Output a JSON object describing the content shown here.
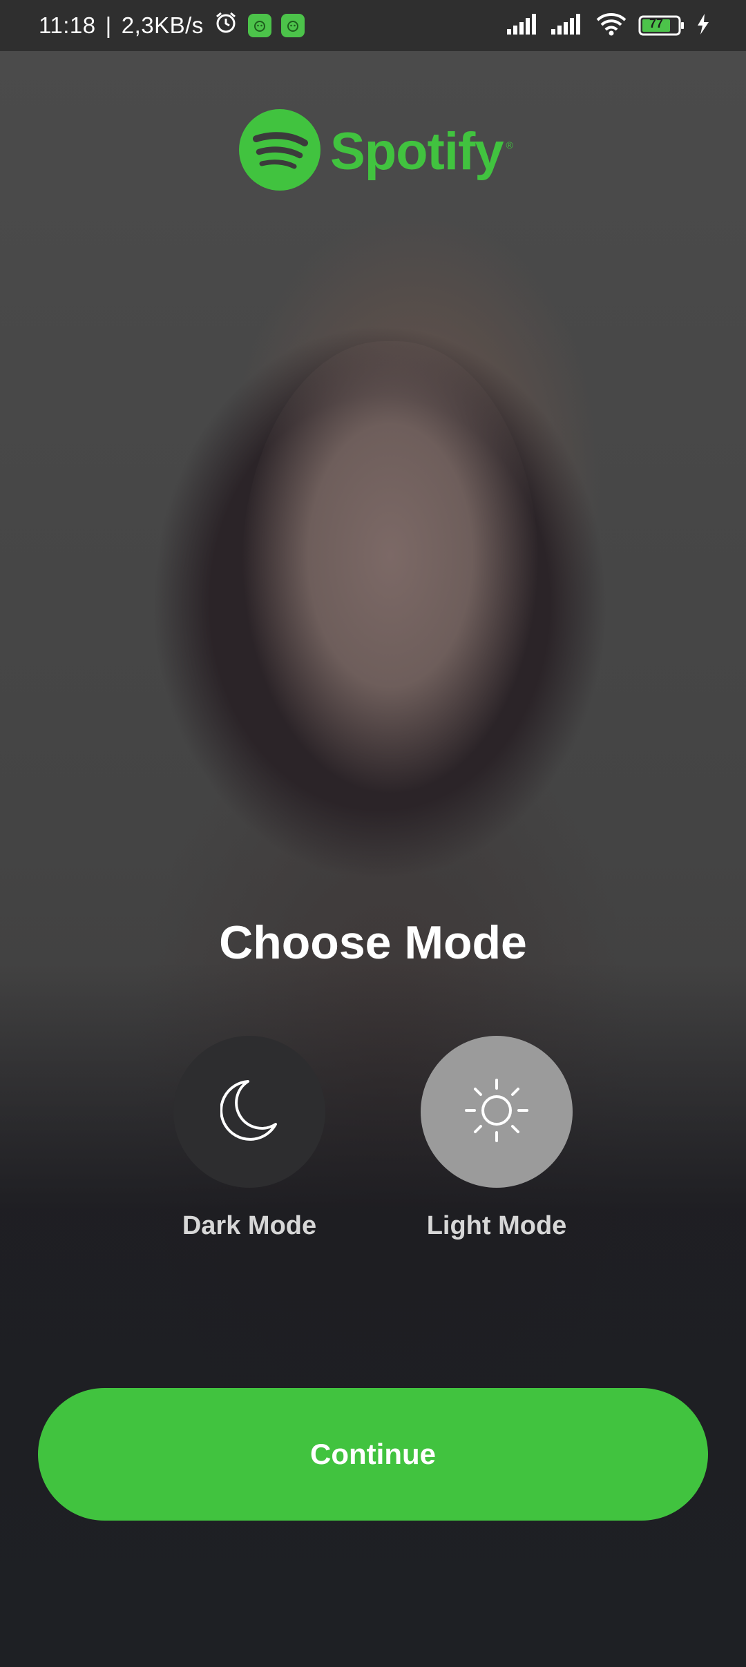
{
  "status_bar": {
    "time": "11:18",
    "separator": "|",
    "speed": "2,3KB/s",
    "battery": "77",
    "icons": [
      "alarm-icon",
      "app-badge-icon",
      "app-badge-icon",
      "signal-icon",
      "signal-icon",
      "wifi-icon",
      "battery-icon",
      "charging-icon"
    ]
  },
  "brand": {
    "name": "Spotify",
    "registered_mark": "®",
    "color": "#41c33f"
  },
  "screen": {
    "title": "Choose Mode",
    "modes": [
      {
        "label": "Dark Mode",
        "icon": "moon-icon",
        "selected": false
      },
      {
        "label": "Light Mode",
        "icon": "sun-icon",
        "selected": true
      }
    ],
    "continue_label": "Continue"
  },
  "colors": {
    "accent": "#41c33f",
    "dark_mode_circle": "#2d2d2f",
    "light_mode_circle": "#9b9b9b"
  }
}
